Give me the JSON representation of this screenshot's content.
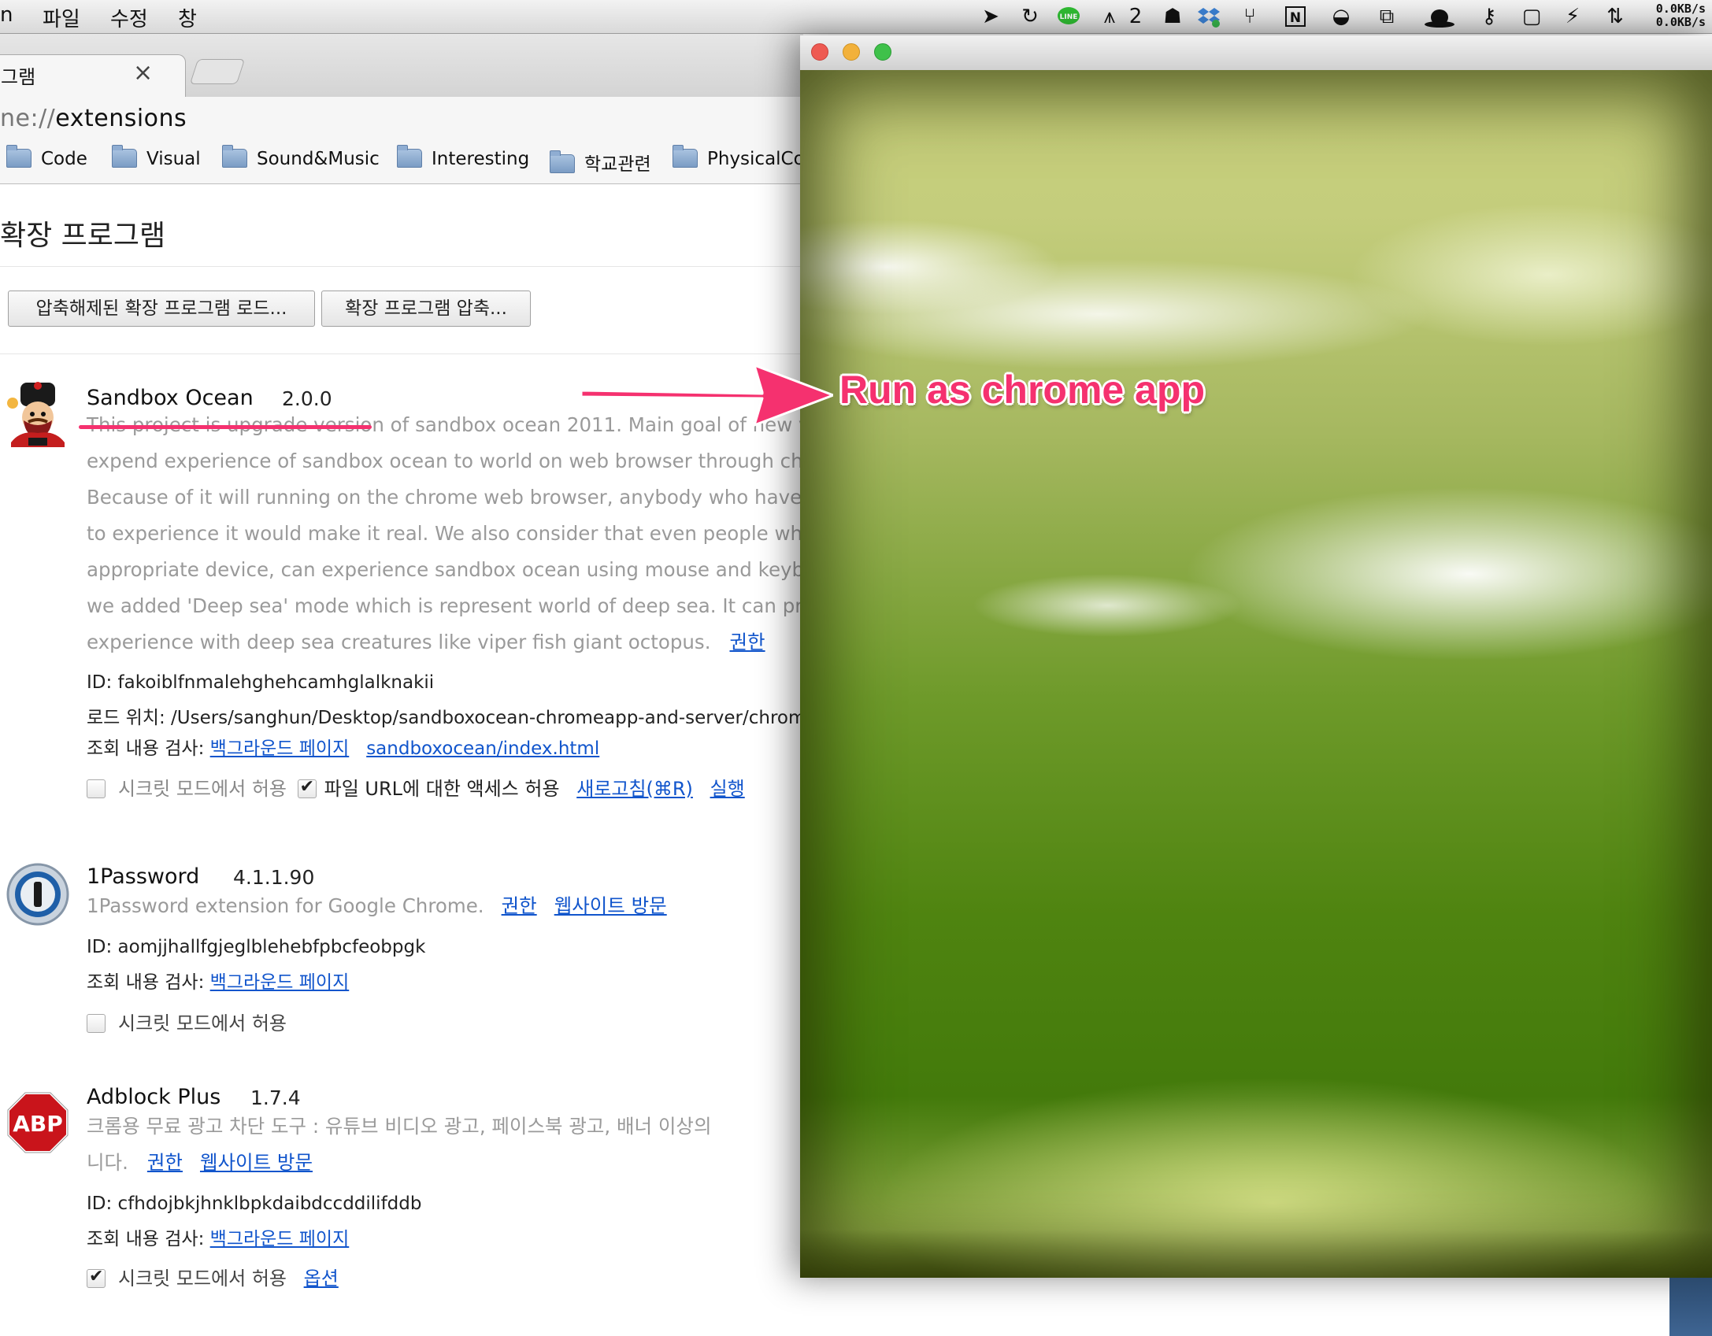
{
  "menubar": {
    "app": "n",
    "items": [
      "파일",
      "수정",
      "창"
    ],
    "tray_number": "2",
    "net_up": "0.0KB/s",
    "net_down": "0.0KB/s"
  },
  "browser": {
    "tab_title": "그램",
    "tab_close": "×",
    "url_prefix": "ne://",
    "url_path": "extensions",
    "bookmarks": [
      "Code",
      "Visual",
      "Sound&Music",
      "Interesting",
      "학교관련",
      "PhysicalCo"
    ]
  },
  "extensions_page": {
    "title": "확장 프로그램",
    "load_unpacked": "압축해제된 확장 프로그램 로드...",
    "pack_extension": "확장 프로그램 압축...",
    "extensions": [
      {
        "name": "Sandbox Ocean",
        "version": "2.0.0",
        "description": [
          "This project is upgrade version of sandbox ocean 2011. Main goal of new vers",
          "expend experience of sandbox ocean to world on web browser through chrome",
          "Because of it will running on the chrome web browser, anybody who have kine",
          "to experience it would make it real. We also consider that even people who do",
          "appropriate device, can experience sandbox ocean using mouse and keyboard",
          "we added 'Deep sea' mode which is represent world of deep sea. It can provide",
          "experience with deep sea creatures like viper fish giant octopus."
        ],
        "permissions_link": "권한",
        "id_line": "ID: fakoiblfnmalehghehcamhglalknakii",
        "load_path": "로드 위치: /Users/sanghun/Desktop/sandboxocean-chromeapp-and-server/chromea",
        "inspect_label": "조회 내용 검사:",
        "inspect_views": [
          "백그라운드 페이지",
          "sandboxocean/index.html"
        ],
        "incognito_label": "시크릿 모드에서 허용",
        "incognito_checked": false,
        "file_url_label": "파일 URL에 대한 액세스 허용",
        "file_url_checked": true,
        "reload_link": "새로고침(⌘R)",
        "launch_link": "실행"
      },
      {
        "name": "1Password",
        "version": "4.1.1.90",
        "description": [
          "1Password extension for Google Chrome."
        ],
        "permissions_link": "권한",
        "website_link": "웹사이트 방문",
        "id_line": "ID: aomjjhallfgjeglblehebfpbcfeobpgk",
        "inspect_label": "조회 내용 검사:",
        "inspect_views": [
          "백그라운드 페이지"
        ],
        "incognito_label": "시크릿 모드에서 허용",
        "incognito_checked": false
      },
      {
        "name": "Adblock Plus",
        "version": "1.7.4",
        "description": [
          "크롬용 무료 광고 차단 도구 : 유튜브 비디오 광고, 페이스북 광고, 배너 이상의",
          "니다."
        ],
        "icon_text": "ABP",
        "permissions_link": "권한",
        "website_link": "웹사이트 방문",
        "id_line": "ID: cfhdojbkjhnklbpkdaibdccddilifddb",
        "inspect_label": "조회 내용 검사:",
        "inspect_views": [
          "백그라운드 페이지"
        ],
        "incognito_label": "시크릿 모드에서 허용",
        "incognito_checked": true,
        "options_link": "옵션"
      }
    ]
  },
  "annotation": {
    "text": "Run as chrome app",
    "color": "#f5316f"
  },
  "colors": {
    "link": "#1155cc",
    "traffic_close": "#ee5a52",
    "traffic_minimize": "#f2b13b",
    "traffic_zoom": "#3fc14a"
  }
}
